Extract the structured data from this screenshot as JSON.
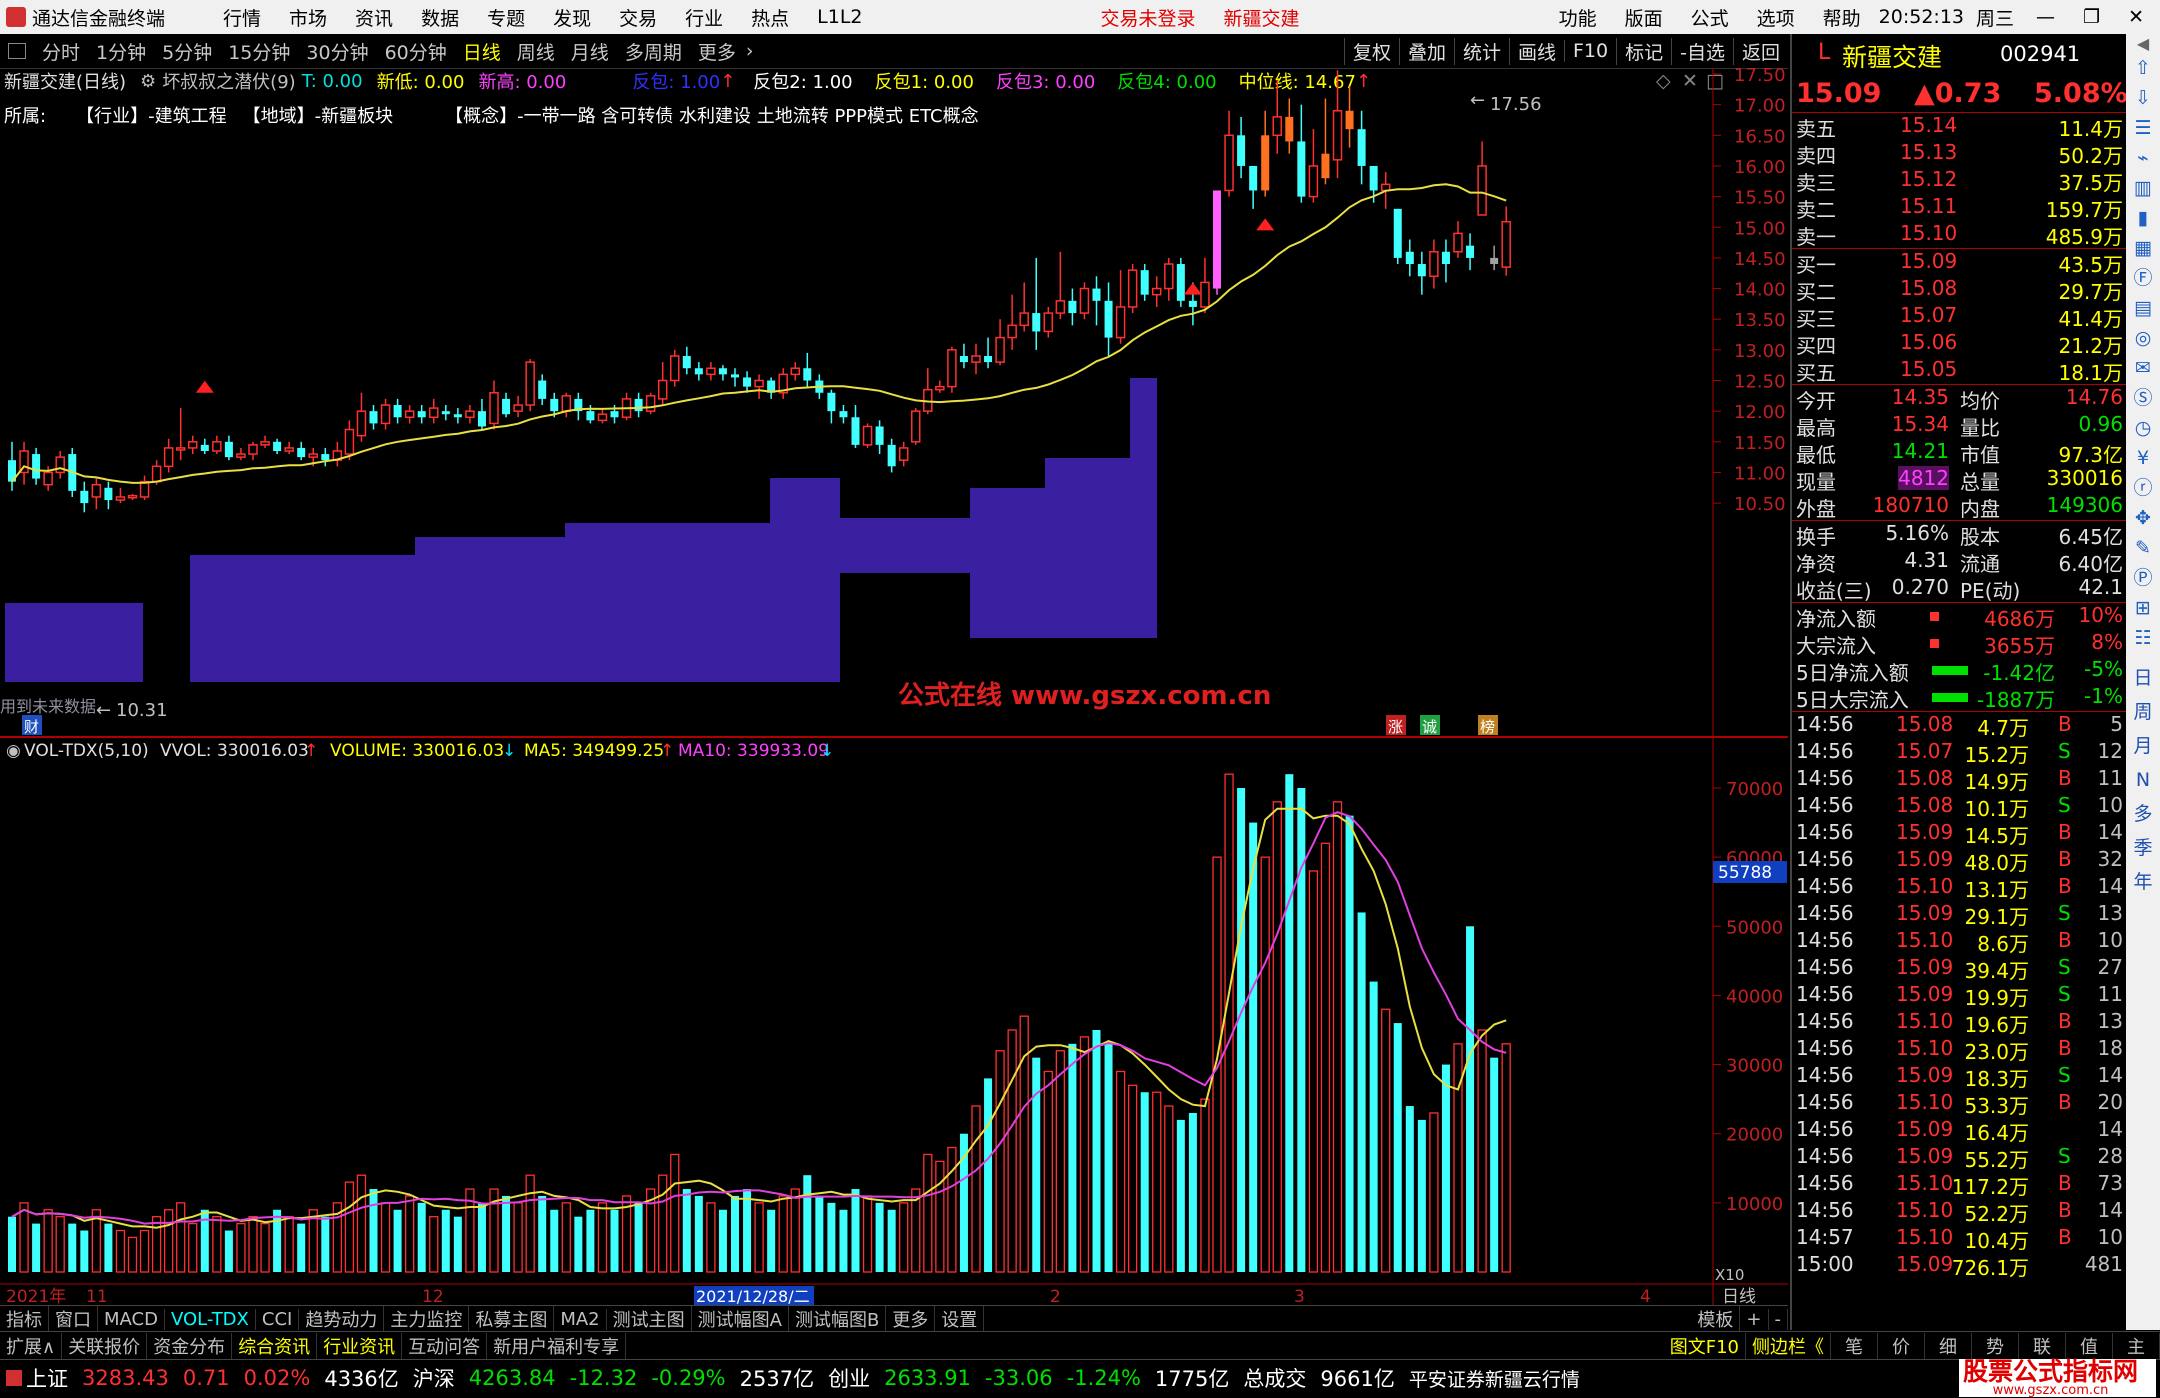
{
  "menubar": {
    "app_title": "通达信金融终端",
    "items": [
      "行情",
      "市场",
      "资讯",
      "数据",
      "专题",
      "发现",
      "交易",
      "行业",
      "热点",
      "L1L2"
    ],
    "login_status": "交易未登录",
    "stock_name": "新疆交建",
    "right_items": [
      "功能",
      "版面",
      "公式",
      "选项",
      "帮助"
    ],
    "time": "20:52:13",
    "weekday": "周三"
  },
  "toolbar": {
    "periods": [
      "分时",
      "1分钟",
      "5分钟",
      "15分钟",
      "30分钟",
      "60分钟",
      "日线",
      "周线",
      "月线",
      "多周期",
      "更多"
    ],
    "active": "日线",
    "right_buttons": [
      "复权",
      "叠加",
      "统计",
      "画线",
      "F10",
      "标记",
      "-自选",
      "返回"
    ]
  },
  "info1": {
    "title": "新疆交建(日线)",
    "indicator": "坏叔叔之潜伏(9)",
    "t": "T: 0.00",
    "xindi": "新低: 0.00",
    "xingao": "新高: 0.00",
    "fanbao": "反包: 1.00",
    "fanbao2": "反包2: 1.00",
    "fanbao1": "反包1: 0.00",
    "fanbao3": "反包3: 0.00",
    "fanbao4": "反包4: 0.00",
    "zhongwei": "中位线: 14.67"
  },
  "info2": {
    "label": "所属:",
    "hangye": "【行业】-建筑工程",
    "diyu": "【地域】-新疆板块",
    "gainian": "【概念】-一带一路 含可转债 水利建设 土地流转 PPP模式 ETC概念"
  },
  "kline": {
    "price_ticks": [
      "17.50",
      "17.00",
      "16.50",
      "16.00",
      "15.50",
      "15.00",
      "14.50",
      "14.00",
      "13.50",
      "13.00",
      "12.50",
      "12.00",
      "11.50",
      "11.00",
      "10.50"
    ],
    "high_label": "17.56",
    "low_label": "10.31",
    "watermark": "公式在线 www.gszx.com.cn",
    "note": "用到未来数据",
    "tag_cai": "财",
    "tag_zhang": "涨",
    "tag_cheng": "诚",
    "tag_bang": "榜"
  },
  "vol_info": {
    "name": "VOL-TDX(5,10)",
    "vvol": "VVOL: 330016.03",
    "volume": "VOLUME: 330016.03",
    "ma5": "MA5: 349499.25",
    "ma10": "MA10: 339933.09",
    "ticks": [
      "70000",
      "60000",
      "50000",
      "40000",
      "30000",
      "20000",
      "10000"
    ],
    "current_box": "55788",
    "unit": "X10"
  },
  "dates": {
    "y2021": "2021年",
    "m11": "11",
    "m12": "12",
    "selected": "2021/12/28/二",
    "m2": "2",
    "m3": "3",
    "m4": "4",
    "period": "日线"
  },
  "tabbar1": {
    "items": [
      "指标",
      "窗口",
      "MACD",
      "VOL-TDX",
      "CCI",
      "趋势动力",
      "主力监控",
      "私募主图",
      "MA2",
      "测试主图",
      "测试幅图A",
      "测试幅图B",
      "更多",
      "设置"
    ],
    "active": "VOL-TDX",
    "right": [
      "模板",
      "+",
      "-"
    ]
  },
  "tabbar2": {
    "items": [
      "扩展∧",
      "关联报价",
      "资金分布",
      "综合资讯",
      "行业资讯",
      "互动问答",
      "新用户福利专享"
    ],
    "right": [
      "图文F10",
      "侧边栏《",
      "笔",
      "价",
      "细",
      "势",
      "联",
      "值",
      "主"
    ]
  },
  "statusbar": {
    "sh_name": "上证",
    "sh_val": "3283.43",
    "sh_chg": "0.71",
    "sh_pct": "0.02%",
    "sh_amt": "4336亿",
    "hs_name": "沪深",
    "hs_val": "4263.84",
    "hs_chg": "-12.32",
    "hs_pct": "-0.29%",
    "hs_amt": "2537亿",
    "cy_name": "创业",
    "cy_val": "2633.91",
    "cy_chg": "-33.06",
    "cy_pct": "-1.24%",
    "cy_amt": "1775亿",
    "total_label": "总成交",
    "total_val": "9661亿",
    "broker": "平安证券新疆云行情",
    "logo": "股票公式指标网",
    "logo_url": "www.gszx.com.cn"
  },
  "quote": {
    "marker": "L",
    "name": "新疆交建",
    "code": "002941",
    "price": "15.09",
    "change": "▲0.73",
    "pct": "5.08%",
    "asks": [
      {
        "label": "卖五",
        "price": "15.14",
        "vol": "11.4万"
      },
      {
        "label": "卖四",
        "price": "15.13",
        "vol": "50.2万"
      },
      {
        "label": "卖三",
        "price": "15.12",
        "vol": "37.5万"
      },
      {
        "label": "卖二",
        "price": "15.11",
        "vol": "159.7万"
      },
      {
        "label": "卖一",
        "price": "15.10",
        "vol": "485.9万"
      }
    ],
    "bids": [
      {
        "label": "买一",
        "price": "15.09",
        "vol": "43.5万"
      },
      {
        "label": "买二",
        "price": "15.08",
        "vol": "29.7万"
      },
      {
        "label": "买三",
        "price": "15.07",
        "vol": "41.4万"
      },
      {
        "label": "买四",
        "price": "15.06",
        "vol": "21.2万"
      },
      {
        "label": "买五",
        "price": "15.05",
        "vol": "18.1万"
      }
    ],
    "stats": [
      {
        "l1": "今开",
        "v1": "14.35",
        "l2": "均价",
        "v2": "14.76"
      },
      {
        "l1": "最高",
        "v1": "15.34",
        "l2": "量比",
        "v2": "0.96"
      },
      {
        "l1": "最低",
        "v1": "14.21",
        "l2": "市值",
        "v2": "97.3亿"
      },
      {
        "l1": "现量",
        "v1": "4812",
        "l2": "总量",
        "v2": "330016"
      },
      {
        "l1": "外盘",
        "v1": "180710",
        "l2": "内盘",
        "v2": "149306"
      }
    ],
    "fund": [
      {
        "l1": "换手",
        "v1": "5.16%",
        "l2": "股本",
        "v2": "6.45亿"
      },
      {
        "l1": "净资",
        "v1": "4.31",
        "l2": "流通",
        "v2": "6.40亿"
      },
      {
        "l1": "收益(三)",
        "v1": "0.270",
        "l2": "PE(动)",
        "v2": "42.1"
      }
    ],
    "flow": [
      {
        "label": "净流入额",
        "val": "4686万",
        "pct": "10%"
      },
      {
        "label": "大宗流入",
        "val": "3655万",
        "pct": "8%"
      },
      {
        "label": "5日净流入额",
        "val": "-1.42亿",
        "pct": "-5%"
      },
      {
        "label": "5日大宗流入",
        "val": "-1887万",
        "pct": "-1%"
      }
    ],
    "ticks": [
      {
        "t": "14:56",
        "p": "15.08",
        "v": "4.7万",
        "d": "B",
        "n": "5"
      },
      {
        "t": "14:56",
        "p": "15.07",
        "v": "15.2万",
        "d": "S",
        "n": "12"
      },
      {
        "t": "14:56",
        "p": "15.08",
        "v": "14.9万",
        "d": "B",
        "n": "11"
      },
      {
        "t": "14:56",
        "p": "15.08",
        "v": "10.1万",
        "d": "S",
        "n": "10"
      },
      {
        "t": "14:56",
        "p": "15.09",
        "v": "14.5万",
        "d": "B",
        "n": "14"
      },
      {
        "t": "14:56",
        "p": "15.09",
        "v": "48.0万",
        "d": "B",
        "n": "32"
      },
      {
        "t": "14:56",
        "p": "15.10",
        "v": "13.1万",
        "d": "B",
        "n": "14"
      },
      {
        "t": "14:56",
        "p": "15.09",
        "v": "29.1万",
        "d": "S",
        "n": "13"
      },
      {
        "t": "14:56",
        "p": "15.10",
        "v": "8.6万",
        "d": "B",
        "n": "10"
      },
      {
        "t": "14:56",
        "p": "15.09",
        "v": "39.4万",
        "d": "S",
        "n": "27"
      },
      {
        "t": "14:56",
        "p": "15.09",
        "v": "19.9万",
        "d": "S",
        "n": "11"
      },
      {
        "t": "14:56",
        "p": "15.10",
        "v": "19.6万",
        "d": "B",
        "n": "13"
      },
      {
        "t": "14:56",
        "p": "15.10",
        "v": "23.0万",
        "d": "B",
        "n": "18"
      },
      {
        "t": "14:56",
        "p": "15.09",
        "v": "18.3万",
        "d": "S",
        "n": "14"
      },
      {
        "t": "14:56",
        "p": "15.10",
        "v": "53.3万",
        "d": "B",
        "n": "20"
      },
      {
        "t": "14:56",
        "p": "15.09",
        "v": "16.4万",
        "d": "",
        "n": "14"
      },
      {
        "t": "14:56",
        "p": "15.09",
        "v": "55.2万",
        "d": "S",
        "n": "28"
      },
      {
        "t": "14:56",
        "p": "15.10",
        "v": "117.2万",
        "d": "B",
        "n": "73"
      },
      {
        "t": "14:56",
        "p": "15.10",
        "v": "52.2万",
        "d": "B",
        "n": "14"
      },
      {
        "t": "14:57",
        "p": "15.10",
        "v": "10.4万",
        "d": "B",
        "n": "10"
      },
      {
        "t": "15:00",
        "p": "15.09",
        "v": "726.1万",
        "d": "",
        "n": "481"
      }
    ]
  },
  "sidebar": {
    "labels": [
      "日",
      "周",
      "月",
      "N",
      "多",
      "季",
      "年"
    ]
  }
}
